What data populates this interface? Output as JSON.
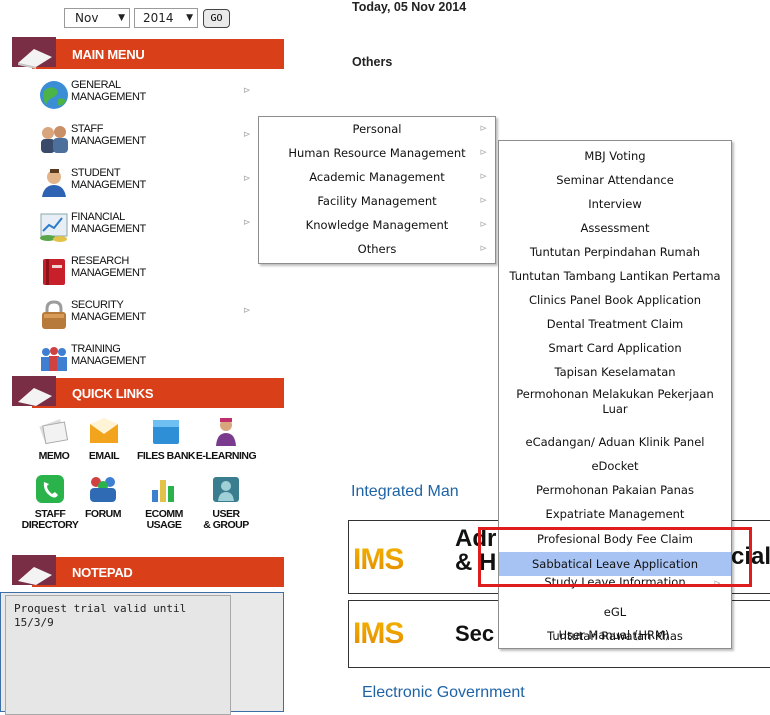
{
  "date_selector": {
    "month": "Nov",
    "year": "2014",
    "go_label": "GO"
  },
  "sidebar": {
    "main_menu_title": "MAIN MENU",
    "items": [
      {
        "line1": "GENERAL",
        "line2": "MANAGEMENT",
        "icon": "globe-icon",
        "has_submenu": true
      },
      {
        "line1": "STAFF",
        "line2": "MANAGEMENT",
        "icon": "staff-people-icon",
        "has_submenu": true
      },
      {
        "line1": "STUDENT",
        "line2": "MANAGEMENT",
        "icon": "student-icon",
        "has_submenu": true
      },
      {
        "line1": "FINANCIAL",
        "line2": "MANAGEMENT",
        "icon": "financial-chart-icon",
        "has_submenu": true
      },
      {
        "line1": "RESEARCH",
        "line2": "MANAGEMENT",
        "icon": "research-book-icon",
        "has_submenu": false
      },
      {
        "line1": "SECURITY",
        "line2": "MANAGEMENT",
        "icon": "padlock-icon",
        "has_submenu": true
      },
      {
        "line1": "TRAINING",
        "line2": "MANAGEMENT",
        "icon": "training-people-icon",
        "has_submenu": false
      }
    ],
    "quick_links_title": "QUICK LINKS",
    "quick_links": [
      {
        "line1": "MEMO",
        "line2": "",
        "icon": "memo-icon"
      },
      {
        "line1": "EMAIL",
        "line2": "",
        "icon": "email-icon"
      },
      {
        "line1": "FILES BANK",
        "line2": "",
        "icon": "files-bank-icon"
      },
      {
        "line1": "E-LEARNING",
        "line2": "",
        "icon": "e-learning-icon"
      },
      {
        "line1": "STAFF",
        "line2": "DIRECTORY",
        "icon": "phone-icon"
      },
      {
        "line1": "FORUM",
        "line2": "",
        "icon": "forum-icon"
      },
      {
        "line1": "ECOMM",
        "line2": "USAGE",
        "icon": "ecomm-chart-icon"
      },
      {
        "line1": "USER",
        "line2": "& GROUP",
        "icon": "user-group-icon"
      }
    ],
    "notepad_title": "NOTEPAD",
    "notepad_text": "Proquest trial valid until 15/3/9"
  },
  "main": {
    "today": "Today, 05 Nov 2014",
    "heading": "Others",
    "integrated_title": "Integrated Man",
    "ims1_logo": "IMS",
    "ims1_text_a": "Adr",
    "ims1_text_b": "& H",
    "ims1_text_right": "cial",
    "ims2_logo": "IMS",
    "ims2_text": "Sec",
    "egov_title": "Electronic Government"
  },
  "menu_level1": [
    {
      "label": "Personal",
      "has_submenu": true
    },
    {
      "label": "Human Resource Management",
      "has_submenu": true
    },
    {
      "label": "Academic Management",
      "has_submenu": true
    },
    {
      "label": "Facility Management",
      "has_submenu": true
    },
    {
      "label": "Knowledge Management",
      "has_submenu": true
    },
    {
      "label": "Others",
      "has_submenu": true
    }
  ],
  "menu_level2": [
    {
      "label": "MBJ Voting"
    },
    {
      "label": "Seminar Attendance"
    },
    {
      "label": "Interview"
    },
    {
      "label": "Assessment"
    },
    {
      "label": "Tuntutan Perpindahan Rumah"
    },
    {
      "label": "Tuntutan Tambang Lantikan Pertama"
    },
    {
      "label": "Clinics Panel Book Application"
    },
    {
      "label": "Dental Treatment Claim"
    },
    {
      "label": "Smart Card Application"
    },
    {
      "label": "Tapisan Keselamatan"
    },
    {
      "label": "Permohonan Melakukan Pekerjaan Luar"
    },
    {
      "label": "eCadangan/ Aduan Klinik Panel"
    },
    {
      "label": "eDocket"
    },
    {
      "label": "Permohonan Pakaian Panas"
    },
    {
      "label": "Expatriate Management"
    },
    {
      "label": "Profesional Body Fee Claim"
    },
    {
      "label": "Sabbatical Leave Application",
      "highlighted": true
    },
    {
      "label": "Study Leave Information",
      "has_submenu": true
    },
    {
      "label": "eGL"
    },
    {
      "label": "Tuntutan Rawatan Khas"
    },
    {
      "label": "User Manual (HRM)"
    }
  ],
  "colors": {
    "header_red": "#d9401a",
    "highlight": "#a7c3f3",
    "link_blue": "#1e63a6",
    "annotation_red": "#e01d1d"
  }
}
